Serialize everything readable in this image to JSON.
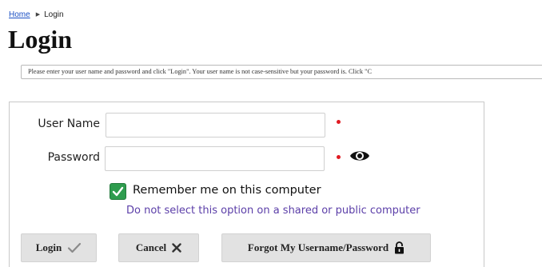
{
  "breadcrumb": {
    "home_label": "Home",
    "separator": "▶",
    "current_label": "Login"
  },
  "page": {
    "title": "Login",
    "instructions": "Please enter your user name and password and click \"Login\". Your user name is not case-sensitive but your password is. Click \"C"
  },
  "form": {
    "username_label": "User Name",
    "username_value": "",
    "password_label": "Password",
    "password_value": "",
    "remember_checked": true,
    "remember_label": "Remember me on this computer",
    "shared_computer_warning": "Do not select this option on a shared or public computer"
  },
  "buttons": {
    "login_label": "Login",
    "cancel_label": "Cancel",
    "forgot_label": "Forgot My Username/Password"
  },
  "icons": {
    "required": "required-dot-icon",
    "show_password": "eye-icon",
    "checkbox": "checkmark-icon",
    "login": "checkmark-icon",
    "cancel": "close-icon",
    "forgot": "lock-icon"
  },
  "colors": {
    "link": "#1a4fc4",
    "required": "#e01b22",
    "checkbox": "#2e9c4e",
    "warning_text": "#5b3ea8",
    "button_bg": "#e2e2e2"
  }
}
